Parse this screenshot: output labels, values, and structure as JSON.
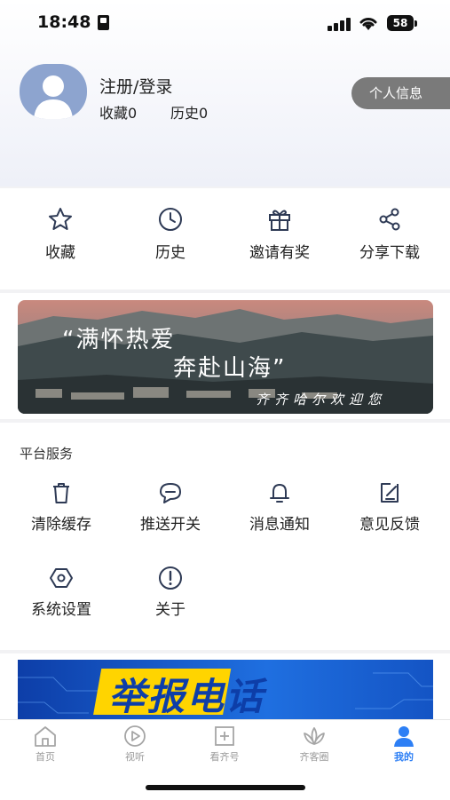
{
  "status_bar": {
    "time": "18:48",
    "battery": "58"
  },
  "header": {
    "login_label": "注册/登录",
    "favorites": "收藏0",
    "history": "历史0",
    "profile_button": "个人信息"
  },
  "quick_actions": [
    {
      "label": "收藏",
      "icon": "star-icon"
    },
    {
      "label": "历史",
      "icon": "clock-icon"
    },
    {
      "label": "邀请有奖",
      "icon": "gift-icon"
    },
    {
      "label": "分享下载",
      "icon": "share-icon"
    }
  ],
  "banner": {
    "line1": "“满怀热爱",
    "line2": "奔赴山海”",
    "caption": "齐齐哈尔欢迎您"
  },
  "services": {
    "title": "平台服务",
    "items": [
      {
        "label": "清除缓存",
        "icon": "trash-icon"
      },
      {
        "label": "推送开关",
        "icon": "chat-bubble-icon"
      },
      {
        "label": "消息通知",
        "icon": "bell-icon"
      },
      {
        "label": "意见反馈",
        "icon": "edit-icon"
      },
      {
        "label": "系统设置",
        "icon": "hexagon-settings-icon"
      },
      {
        "label": "关于",
        "icon": "info-icon"
      }
    ]
  },
  "report_banner": {
    "text": "举报电话"
  },
  "tabbar": {
    "items": [
      {
        "label": "首页",
        "icon": "home-icon",
        "active": false
      },
      {
        "label": "视听",
        "icon": "play-icon",
        "active": false
      },
      {
        "label": "看齐号",
        "icon": "add-box-icon",
        "active": false
      },
      {
        "label": "齐客圈",
        "icon": "lotus-icon",
        "active": false
      },
      {
        "label": "我的",
        "icon": "user-icon",
        "active": true
      }
    ]
  },
  "colors": {
    "accent": "#2d7ff5",
    "avatar_bg": "#8da4cf",
    "profile_button_bg": "#7a7a7a"
  }
}
